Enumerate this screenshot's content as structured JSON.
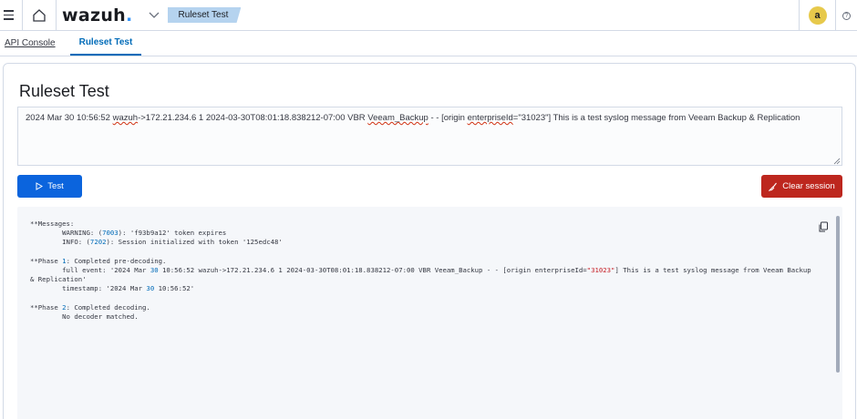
{
  "header": {
    "logo_text": "wazuh",
    "logo_dot": ".",
    "breadcrumb": "Ruleset Test",
    "avatar_letter": "a",
    "help_glyph": "?"
  },
  "tabs": [
    {
      "label": "API Console",
      "active": false
    },
    {
      "label": "Ruleset Test",
      "active": true
    }
  ],
  "main": {
    "title": "Ruleset Test",
    "log_input": {
      "part1": "2024 Mar 30 10:56:52 ",
      "word1": "wazuh",
      "part2": "->172.21.234.6 1 2024-03-30T08:01:18.838212-07:00 VBR ",
      "word2": "Veeam_Backup",
      "part3": " - - [origin ",
      "word3": "enterpriseId",
      "part4": "=\"31023\"] This is a test syslog message from Veeam Backup & Replication"
    },
    "test_button": "Test",
    "clear_button": "Clear session"
  },
  "output": {
    "l1": "**Messages:",
    "l2a": "\tWARNING: (",
    "l2n": "7003",
    "l2b": "): 'f93b9a12' token expires",
    "l3a": "\tINFO: (",
    "l3n": "7202",
    "l3b": "): Session initialized with token '125edc48'",
    "l4a": "**Phase ",
    "l4n": "1",
    "l4b": ": Completed pre-decoding.",
    "l5a": "\tfull event: '2024 Mar ",
    "l5n1": "30",
    "l5b": " 10:56:52 wazuh->172.21.234.6 1 2024-03-30T08:01:18.838212-07:00 VBR Veeam_Backup - - [origin enterpriseId=",
    "l5s": "\"31023\"",
    "l5c": "] This is a test syslog message from Veeam Backup & Replication'",
    "l6a": "\ttimestamp: '2024 Mar ",
    "l6n": "30",
    "l6b": " 10:56:52'",
    "l7a": "**Phase ",
    "l7n": "2",
    "l7b": ": Completed decoding.",
    "l8": "\tNo decoder matched."
  },
  "colors": {
    "primary": "#0b64dd",
    "danger": "#bd271e",
    "avatar": "#e7c94b",
    "breadcrumb": "#b5d3ef"
  },
  "icons": [
    "hamburger-icon",
    "home-icon",
    "chevron-down-icon",
    "play-icon",
    "broom-icon",
    "copy-icon",
    "help-icon"
  ]
}
